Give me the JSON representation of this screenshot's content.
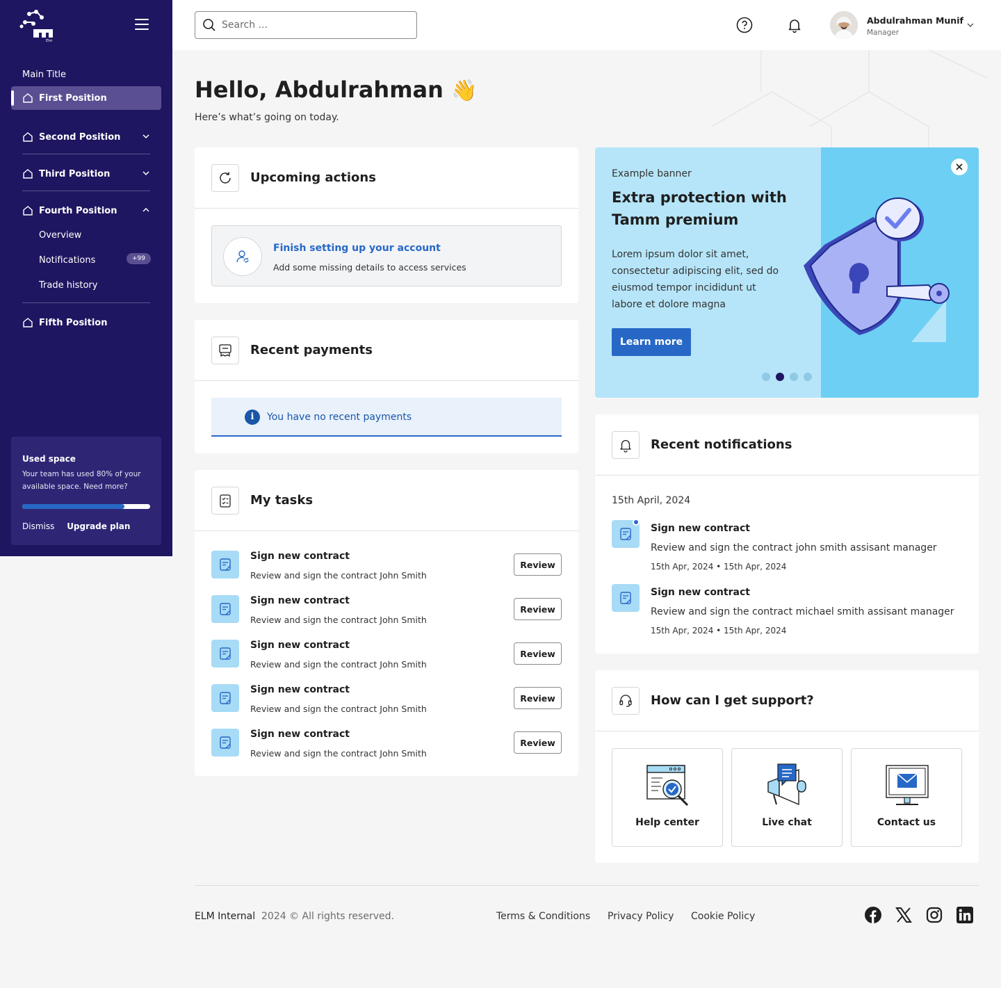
{
  "sidebar": {
    "logo_text": "Elm",
    "main_title": "Main Title",
    "items": [
      {
        "label": "First Position"
      },
      {
        "label": "Second Position"
      },
      {
        "label": "Third Position"
      },
      {
        "label": "Fourth Position"
      },
      {
        "label": "Fifth Position"
      }
    ],
    "sub_items": [
      {
        "label": "Overview"
      },
      {
        "label": "Notifications",
        "badge": "+99"
      },
      {
        "label": "Trade history"
      }
    ],
    "space": {
      "title": "Used space",
      "text": "Your team has used 80% of your available space. Need more?",
      "used_fraction": 0.8,
      "dismiss": "Dismiss",
      "upgrade": "Upgrade plan"
    }
  },
  "header": {
    "search_placeholder": "Search ...",
    "user_name": "Abdulrahman Munif",
    "user_role": "Manager"
  },
  "greeting": {
    "title": "Hello, Abdulrahman",
    "emoji": "👋",
    "subtitle": "Here’s what’s going on today."
  },
  "upcoming": {
    "title": "Upcoming actions",
    "item_title": "Finish setting up your account",
    "item_desc": "Add some missing details to access services"
  },
  "payments": {
    "title": "Recent payments",
    "empty": "You have no recent payments",
    "info_glyph": "i"
  },
  "tasks": {
    "title": "My tasks",
    "items": [
      {
        "title": "Sign new contract",
        "desc": "Review and sign the contract John Smith",
        "action": "Review"
      },
      {
        "title": "Sign new contract",
        "desc": "Review and sign the contract John Smith",
        "action": "Review"
      },
      {
        "title": "Sign new contract",
        "desc": "Review and sign the contract John Smith",
        "action": "Review"
      },
      {
        "title": "Sign new contract",
        "desc": "Review and sign the contract John Smith",
        "action": "Review"
      },
      {
        "title": "Sign new contract",
        "desc": "Review and sign the contract John Smith",
        "action": "Review"
      }
    ]
  },
  "banner": {
    "eyebrow": "Example banner",
    "title": "Extra protection with Tamm premium",
    "text": "Lorem ipsum dolor sit amet, consectetur adipiscing elit, sed do eiusmod tempor incididunt ut labore et dolore magna",
    "button": "Learn more",
    "active_slide": 2,
    "slide_count": 4
  },
  "notifications": {
    "title": "Recent notifications",
    "date": "15th April, 2024",
    "items": [
      {
        "title": "Sign new contract",
        "desc": "Review and sign the contract john smith assisant manager",
        "meta": "15th Apr, 2024 • 15th Apr, 2024",
        "unread": true
      },
      {
        "title": "Sign new contract",
        "desc": "Review and sign the contract michael smith assisant manager",
        "meta": "15th Apr, 2024 • 15th Apr, 2024",
        "unread": false
      }
    ]
  },
  "support": {
    "title": "How can I get support?",
    "tiles": [
      {
        "label": "Help center"
      },
      {
        "label": "Live chat"
      },
      {
        "label": "Contact us"
      }
    ]
  },
  "footer": {
    "brand": "ELM Internal",
    "copyright": "2024 © All rights reserved.",
    "links": [
      {
        "label": "Terms & Conditions"
      },
      {
        "label": "Privacy Policy"
      },
      {
        "label": "Cookie Policy"
      }
    ]
  },
  "colors": {
    "sidebar": "#1e1660",
    "primary": "#2768c6",
    "banner_bg": "#b6e5f9",
    "banner_accent": "#6dcff3",
    "task_icon_bg": "#a7dbf6"
  }
}
